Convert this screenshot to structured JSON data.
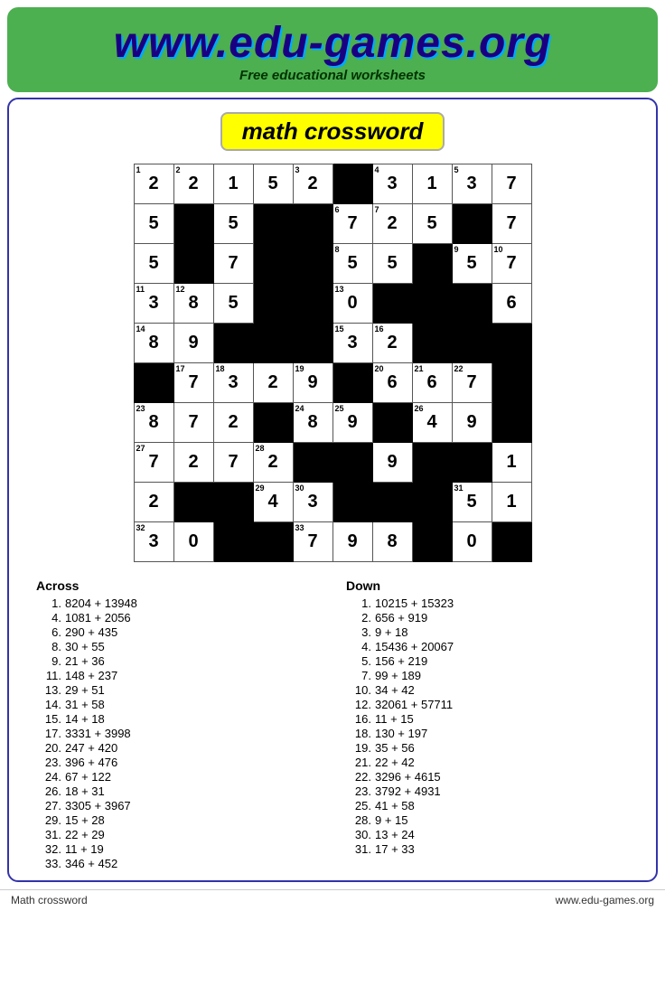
{
  "header": {
    "url": "www.edu-games.org",
    "subtitle": "Free educational worksheets"
  },
  "page_title": "math crossword",
  "footer": {
    "left": "Math crossword",
    "right": "www.edu-games.org"
  },
  "grid": [
    [
      {
        "val": "2",
        "num": "1"
      },
      {
        "val": "2",
        "num": "2"
      },
      {
        "val": "1",
        "num": ""
      },
      {
        "val": "5",
        "num": ""
      },
      {
        "val": "2",
        "num": "3"
      },
      {
        "b": true
      },
      {
        "val": "3",
        "num": "4"
      },
      {
        "val": "1",
        "num": ""
      },
      {
        "val": "3",
        "num": "5"
      },
      {
        "val": "7",
        "num": ""
      }
    ],
    [
      {
        "val": "5",
        "num": ""
      },
      {
        "b": true
      },
      {
        "val": "5",
        "num": ""
      },
      {
        "b": true
      },
      {
        "b": true
      },
      {
        "val": "7",
        "num": "6"
      },
      {
        "val": "2",
        "num": "7"
      },
      {
        "val": "5",
        "num": ""
      },
      {
        "b": true
      },
      {
        "val": "7",
        "num": ""
      }
    ],
    [
      {
        "val": "5",
        "num": ""
      },
      {
        "b": true
      },
      {
        "val": "7",
        "num": ""
      },
      {
        "b": true
      },
      {
        "b": true
      },
      {
        "val": "5",
        "num": "8"
      },
      {
        "val": "5",
        "num": ""
      },
      {
        "b": true
      },
      {
        "val": "5",
        "num": "9"
      },
      {
        "val": "7",
        "num": "10"
      }
    ],
    [
      {
        "val": "3",
        "num": "11"
      },
      {
        "val": "8",
        "num": "12"
      },
      {
        "val": "5",
        "num": ""
      },
      {
        "b": true
      },
      {
        "b": true
      },
      {
        "val": "0",
        "num": "13"
      },
      {
        "b": true
      },
      {
        "b": true
      },
      {
        "b": true
      },
      {
        "val": "6",
        "num": ""
      }
    ],
    [
      {
        "val": "8",
        "num": "14"
      },
      {
        "val": "9",
        "num": ""
      },
      {
        "b": true
      },
      {
        "b": true
      },
      {
        "b": true
      },
      {
        "val": "3",
        "num": "15"
      },
      {
        "val": "2",
        "num": "16"
      },
      {
        "b": true
      },
      {
        "b": true
      },
      {
        "b": true
      }
    ],
    [
      {
        "b": true
      },
      {
        "val": "7",
        "num": "17"
      },
      {
        "val": "3",
        "num": "18"
      },
      {
        "val": "2",
        "num": ""
      },
      {
        "val": "9",
        "num": "19"
      },
      {
        "b": true
      },
      {
        "val": "6",
        "num": "20"
      },
      {
        "val": "6",
        "num": "21"
      },
      {
        "val": "7",
        "num": "22"
      },
      {
        "b": true
      }
    ],
    [
      {
        "val": "8",
        "num": "23"
      },
      {
        "val": "7",
        "num": ""
      },
      {
        "val": "2",
        "num": ""
      },
      {
        "b": true
      },
      {
        "val": "8",
        "num": "24"
      },
      {
        "val": "9",
        "num": "25"
      },
      {
        "b": true
      },
      {
        "val": "4",
        "num": "26"
      },
      {
        "val": "9",
        "num": ""
      },
      {
        "b": true
      }
    ],
    [
      {
        "val": "7",
        "num": "27"
      },
      {
        "val": "2",
        "num": ""
      },
      {
        "val": "7",
        "num": ""
      },
      {
        "val": "2",
        "num": "28"
      },
      {
        "b": true
      },
      {
        "b": true
      },
      {
        "val": "9",
        "num": ""
      },
      {
        "b": true
      },
      {
        "b": true
      },
      {
        "val": "1",
        "num": ""
      }
    ],
    [
      {
        "val": "2",
        "num": ""
      },
      {
        "b": true
      },
      {
        "b": true
      },
      {
        "val": "4",
        "num": "29"
      },
      {
        "val": "3",
        "num": "30"
      },
      {
        "b": true
      },
      {
        "b": true
      },
      {
        "b": true
      },
      {
        "val": "5",
        "num": "31"
      },
      {
        "val": "1",
        "num": ""
      }
    ],
    [
      {
        "val": "3",
        "num": "32"
      },
      {
        "val": "0",
        "num": ""
      },
      {
        "b": true
      },
      {
        "b": true
      },
      {
        "val": "7",
        "num": "33"
      },
      {
        "val": "9",
        "num": ""
      },
      {
        "val": "8",
        "num": ""
      },
      {
        "b": true
      },
      {
        "val": "0",
        "num": ""
      },
      {
        "b": true
      }
    ]
  ],
  "clues": {
    "across": [
      {
        "num": "1.",
        "clue": "8204 + 13948"
      },
      {
        "num": "4.",
        "clue": "1081 + 2056"
      },
      {
        "num": "6.",
        "clue": "290 + 435"
      },
      {
        "num": "8.",
        "clue": "30 + 55"
      },
      {
        "num": "9.",
        "clue": "21 + 36"
      },
      {
        "num": "11.",
        "clue": "148 + 237"
      },
      {
        "num": "13.",
        "clue": "29 + 51"
      },
      {
        "num": "14.",
        "clue": "31 + 58"
      },
      {
        "num": "15.",
        "clue": "14 + 18"
      },
      {
        "num": "17.",
        "clue": "3331 + 3998"
      },
      {
        "num": "20.",
        "clue": "247 + 420"
      },
      {
        "num": "23.",
        "clue": "396 + 476"
      },
      {
        "num": "24.",
        "clue": "67 + 122"
      },
      {
        "num": "26.",
        "clue": "18 + 31"
      },
      {
        "num": "27.",
        "clue": "3305 + 3967"
      },
      {
        "num": "29.",
        "clue": "15 + 28"
      },
      {
        "num": "31.",
        "clue": "22 + 29"
      },
      {
        "num": "32.",
        "clue": "11 + 19"
      },
      {
        "num": "33.",
        "clue": "346 + 452"
      }
    ],
    "down": [
      {
        "num": "1.",
        "clue": "10215 + 15323"
      },
      {
        "num": "2.",
        "clue": "656 + 919"
      },
      {
        "num": "3.",
        "clue": "9 + 18"
      },
      {
        "num": "4.",
        "clue": "15436 + 20067"
      },
      {
        "num": "5.",
        "clue": "156 + 219"
      },
      {
        "num": "7.",
        "clue": "99 + 189"
      },
      {
        "num": "10.",
        "clue": "34 + 42"
      },
      {
        "num": "12.",
        "clue": "32061 + 57711"
      },
      {
        "num": "16.",
        "clue": "11 + 15"
      },
      {
        "num": "18.",
        "clue": "130 + 197"
      },
      {
        "num": "19.",
        "clue": "35 + 56"
      },
      {
        "num": "21.",
        "clue": "22 + 42"
      },
      {
        "num": "22.",
        "clue": "3296 + 4615"
      },
      {
        "num": "23.",
        "clue": "3792 + 4931"
      },
      {
        "num": "25.",
        "clue": "41 + 58"
      },
      {
        "num": "28.",
        "clue": "9 + 15"
      },
      {
        "num": "30.",
        "clue": "13 + 24"
      },
      {
        "num": "31.",
        "clue": "17 + 33"
      }
    ]
  }
}
